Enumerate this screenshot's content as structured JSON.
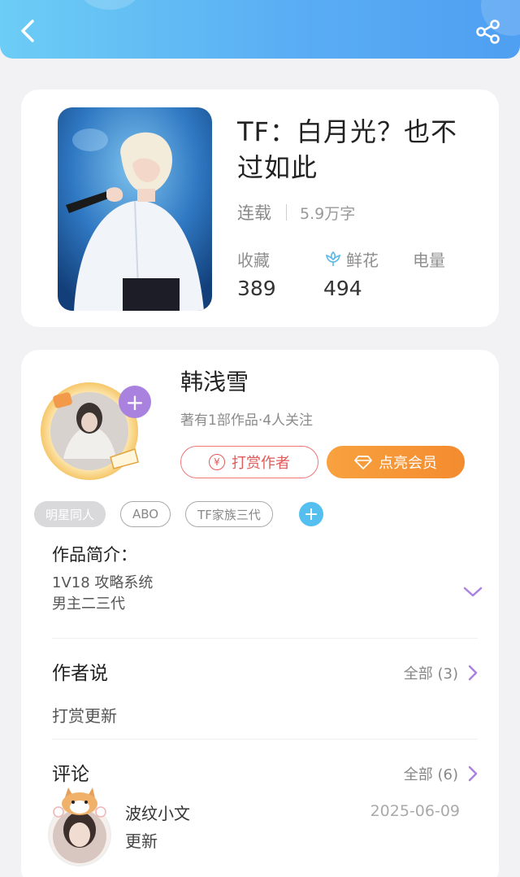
{
  "header": {
    "back_icon": "chevron-left-icon",
    "share_icon": "share-icon",
    "colors": {
      "gradient_start": "#6ccdf5",
      "gradient_end": "#4f9ff2"
    }
  },
  "book": {
    "title": "TF：白月光？也不过如此",
    "status": "连载",
    "word_count": "5.9万字",
    "stats": [
      {
        "label": "收藏",
        "value": "389"
      },
      {
        "label": "鲜花",
        "value": "494"
      },
      {
        "label": "电量",
        "value": ""
      }
    ]
  },
  "author": {
    "name": "韩浅雪",
    "info": "著有1部作品·4人关注",
    "tip_label": "打赏作者",
    "vip_label": "点亮会员",
    "tip_coin": "¥"
  },
  "tags": [
    "明星同人",
    "ABO",
    "TF家族三代"
  ],
  "intro": {
    "title": "作品简介：",
    "lines": [
      "1V18 攻略系统",
      "男主二三代"
    ]
  },
  "author_say": {
    "title": "作者说",
    "more": "全部 (3)",
    "text": "打赏更新"
  },
  "comments": {
    "title": "评论",
    "more": "全部 (6)",
    "items": [
      {
        "user": "波纹小文",
        "date": "2025-06-09",
        "text": "更新"
      }
    ]
  },
  "colors": {
    "accent_orange": "#f48b2f",
    "accent_red": "#e05a5a",
    "accent_purple": "#a982e0",
    "accent_blue": "#55bff0"
  }
}
